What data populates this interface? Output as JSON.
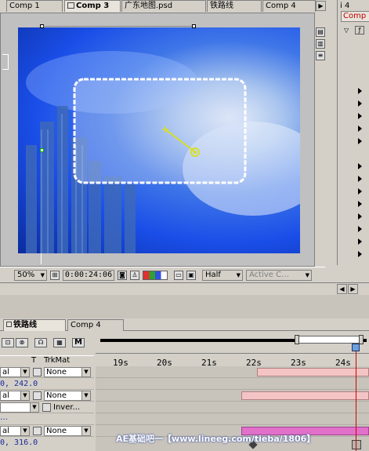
{
  "comp_tabs": [
    {
      "label": "Comp 1",
      "active": false
    },
    {
      "label": "Comp 3",
      "active": true
    },
    {
      "label": "广东地图.psd",
      "active": false
    },
    {
      "label": "铁路线",
      "active": false
    },
    {
      "label": "Comp 4",
      "active": false
    }
  ],
  "right_panel": {
    "tab_number": "i 4",
    "tab_label": "Comp",
    "row_count_triangles": 14
  },
  "viewer_toolbar": {
    "zoom": "50%",
    "timecode": "0:00:24:06",
    "resolution": "Half",
    "camera": "Active C…"
  },
  "timeline_tabs": [
    {
      "label": "铁路线"
    },
    {
      "label": "Comp 4"
    }
  ],
  "timeline_header": {
    "col_t": "T",
    "col_trkmat": "TrkMat",
    "btn_m": "M"
  },
  "ruler_labels": [
    "19s",
    "20s",
    "21s",
    "22s",
    "23s",
    "24s"
  ],
  "layers": [
    {
      "mode": "al",
      "trkmat": "None"
    },
    {
      "value": "0, 242.0"
    },
    {
      "mode": "al",
      "trkmat": "None"
    },
    {
      "mode": "",
      "trkmat": "Inver..."
    },
    {
      "mode": "al",
      "trkmat": "None"
    },
    {
      "value": "0, 316.0"
    }
  ],
  "watermark": "AE基础吧一【www.lineeg.com/tieba/1806】",
  "colors": {
    "panel_bg": "#d4d0c8",
    "selection_box": "#ffffff",
    "motion_path": "#d8e020",
    "layer_bar": "#f4c4c4",
    "current_time": "#d00000",
    "canvas_blue": "#1a4ee8"
  }
}
